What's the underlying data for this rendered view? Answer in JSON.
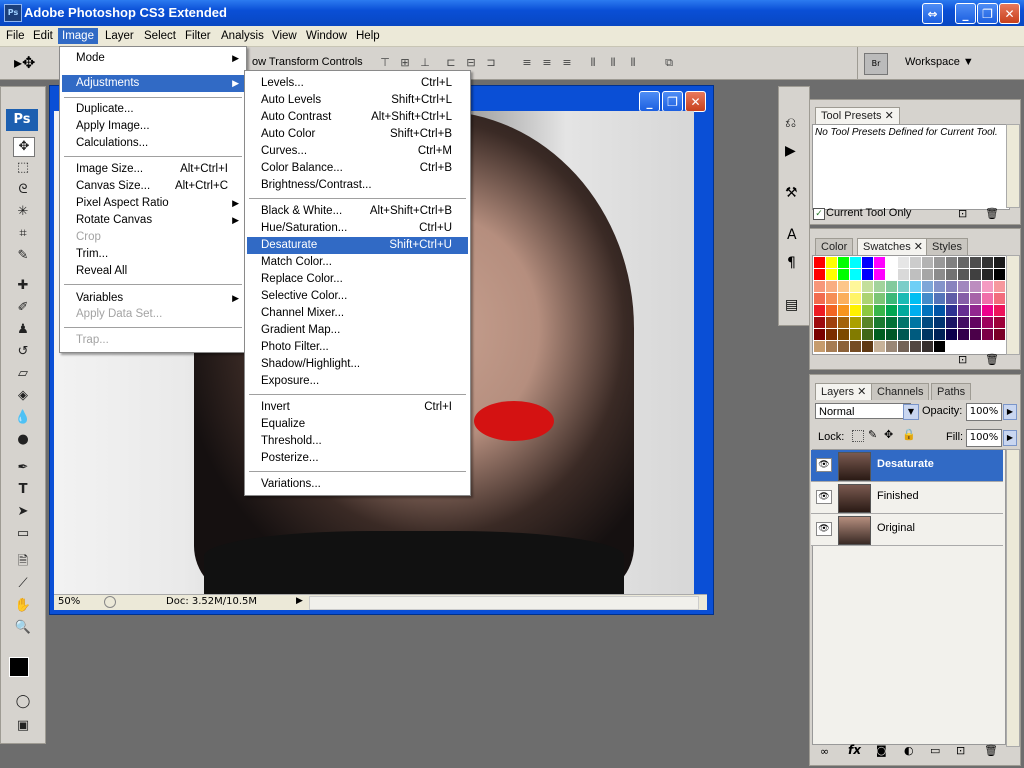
{
  "titlebar": {
    "title": "Adobe Photoshop CS3 Extended",
    "icon": "Ps"
  },
  "menubar": [
    "File",
    "Edit",
    "Image",
    "Layer",
    "Select",
    "Filter",
    "Analysis",
    "View",
    "Window",
    "Help"
  ],
  "options_bar": {
    "show_transform": "ow Transform Controls",
    "workspace": "Workspace ▼"
  },
  "image_menu": {
    "items": [
      {
        "label": "Mode",
        "arrow": true
      },
      {
        "label": "Adjustments",
        "arrow": true,
        "highlighted": true
      },
      {
        "label": "Duplicate..."
      },
      {
        "label": "Apply Image..."
      },
      {
        "label": "Calculations..."
      },
      {
        "label": "Image Size...",
        "shortcut": "Alt+Ctrl+I"
      },
      {
        "label": "Canvas Size...",
        "shortcut": "Alt+Ctrl+C"
      },
      {
        "label": "Pixel Aspect Ratio",
        "arrow": true
      },
      {
        "label": "Rotate Canvas",
        "arrow": true
      },
      {
        "label": "Crop",
        "disabled": true
      },
      {
        "label": "Trim..."
      },
      {
        "label": "Reveal All"
      },
      {
        "label": "Variables",
        "arrow": true
      },
      {
        "label": "Apply Data Set...",
        "disabled": true
      },
      {
        "label": "Trap...",
        "disabled": true
      }
    ]
  },
  "adjustments_menu": {
    "items": [
      {
        "label": "Levels...",
        "shortcut": "Ctrl+L"
      },
      {
        "label": "Auto Levels",
        "shortcut": "Shift+Ctrl+L"
      },
      {
        "label": "Auto Contrast",
        "shortcut": "Alt+Shift+Ctrl+L"
      },
      {
        "label": "Auto Color",
        "shortcut": "Shift+Ctrl+B"
      },
      {
        "label": "Curves...",
        "shortcut": "Ctrl+M"
      },
      {
        "label": "Color Balance...",
        "shortcut": "Ctrl+B"
      },
      {
        "label": "Brightness/Contrast..."
      },
      {
        "label": "Black & White...",
        "shortcut": "Alt+Shift+Ctrl+B"
      },
      {
        "label": "Hue/Saturation...",
        "shortcut": "Ctrl+U"
      },
      {
        "label": "Desaturate",
        "shortcut": "Shift+Ctrl+U",
        "highlighted": true
      },
      {
        "label": "Match Color..."
      },
      {
        "label": "Replace Color..."
      },
      {
        "label": "Selective Color..."
      },
      {
        "label": "Channel Mixer..."
      },
      {
        "label": "Gradient Map..."
      },
      {
        "label": "Photo Filter..."
      },
      {
        "label": "Shadow/Highlight..."
      },
      {
        "label": "Exposure..."
      },
      {
        "label": "Invert",
        "shortcut": "Ctrl+I"
      },
      {
        "label": "Equalize"
      },
      {
        "label": "Threshold..."
      },
      {
        "label": "Posterize..."
      },
      {
        "label": "Variations..."
      }
    ]
  },
  "statusbar": {
    "zoom": "50%",
    "doc": "Doc: 3.52M/10.5M"
  },
  "tool_presets": {
    "tab": "Tool Presets",
    "empty_text": "No Tool Presets Defined for Current Tool.",
    "current_tool_only": "Current Tool Only"
  },
  "swatches_panel": {
    "tabs": [
      "Color",
      "Swatches",
      "Styles"
    ]
  },
  "layers_panel": {
    "tabs": [
      "Layers",
      "Channels",
      "Paths"
    ],
    "blend_mode": "Normal",
    "opacity_label": "Opacity:",
    "opacity": "100%",
    "lock_label": "Lock:",
    "fill_label": "Fill:",
    "fill": "100%",
    "layers": [
      {
        "name": "Desaturate",
        "selected": true
      },
      {
        "name": "Finished"
      },
      {
        "name": "Original"
      }
    ]
  },
  "colors": {
    "accent": "#316ac5",
    "title_blue": "#0a4fd6",
    "fg_color": "#000000",
    "bg_color": "#ff00ff"
  }
}
